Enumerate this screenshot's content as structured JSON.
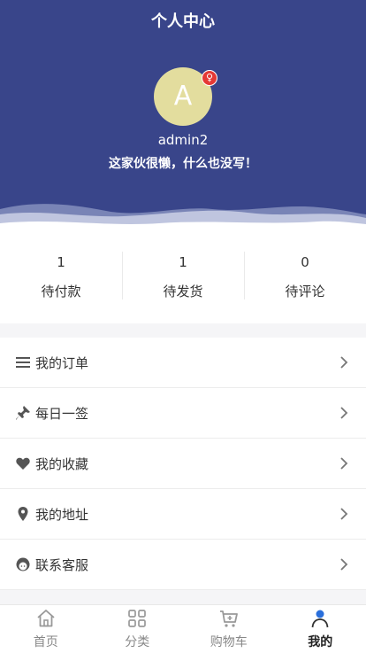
{
  "header": {
    "title": "个人中心",
    "avatar_letter": "A",
    "gender_symbol": "♀",
    "username": "admin2",
    "signature": "这家伙很懒，什么也没写！"
  },
  "stats": [
    {
      "count": "1",
      "label": "待付款"
    },
    {
      "count": "1",
      "label": "待发货"
    },
    {
      "count": "0",
      "label": "待评论"
    }
  ],
  "menu": [
    {
      "label": "我的订单",
      "icon": "list-icon"
    },
    {
      "label": "每日一签",
      "icon": "pin-icon"
    },
    {
      "label": "我的收藏",
      "icon": "heart-icon"
    },
    {
      "label": "我的地址",
      "icon": "location-icon"
    },
    {
      "label": "联系客服",
      "icon": "support-icon"
    }
  ],
  "tabbar": [
    {
      "label": "首页",
      "icon": "home-icon"
    },
    {
      "label": "分类",
      "icon": "grid-icon"
    },
    {
      "label": "购物车",
      "icon": "cart-icon"
    },
    {
      "label": "我的",
      "icon": "user-icon",
      "active": true
    }
  ],
  "colors": {
    "header_bg": "#39458a",
    "avatar_bg": "#e3dd9e",
    "badge": "#e53935"
  }
}
